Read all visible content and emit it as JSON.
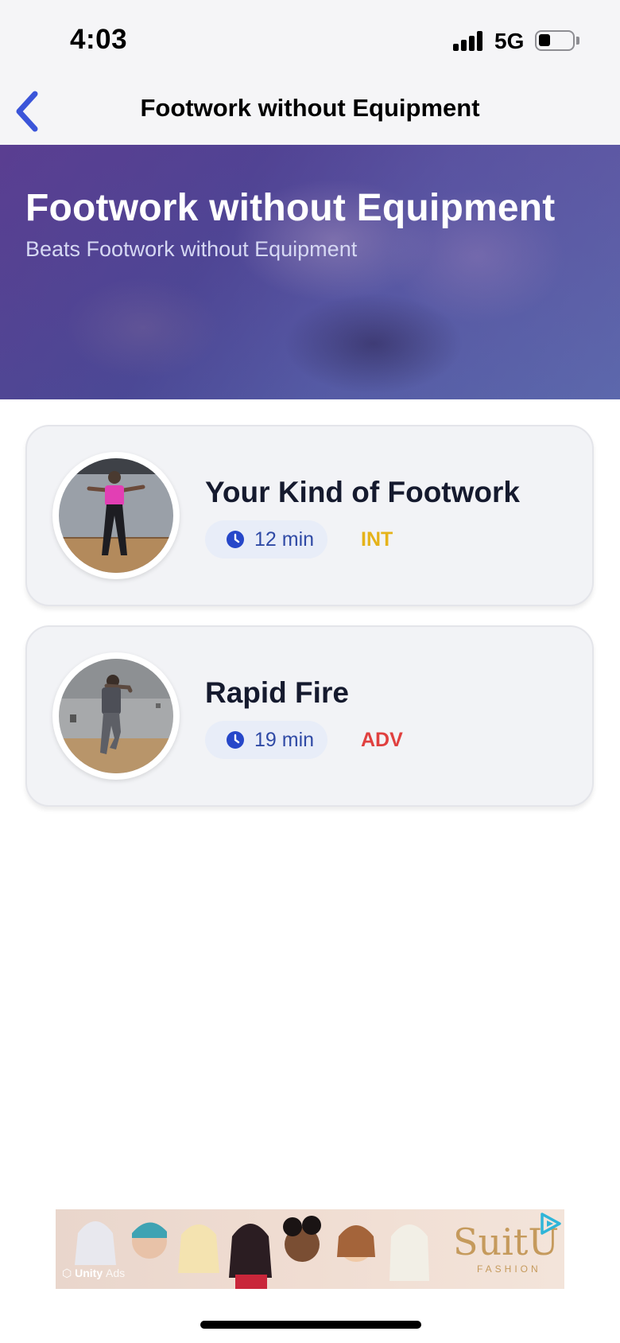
{
  "status_bar": {
    "time": "4:03",
    "network": "5G",
    "battery_level": 0.35
  },
  "nav": {
    "title": "Footwork without Equipment",
    "back_icon": "chevron-left-icon",
    "accent_color": "#3b55d9"
  },
  "hero": {
    "title": "Footwork without Equipment",
    "subtitle": "Beats Footwork without Equipment"
  },
  "workouts": [
    {
      "title": "Your Kind of Footwork",
      "duration": "12 min",
      "level": "INT",
      "level_color": "#e5b31a"
    },
    {
      "title": "Rapid Fire",
      "duration": "19 min",
      "level": "ADV",
      "level_color": "#e0403f"
    }
  ],
  "ad": {
    "brand": "SuitU",
    "tagline": "FASHION",
    "provider": "Unity",
    "provider_suffix": "Ads"
  }
}
